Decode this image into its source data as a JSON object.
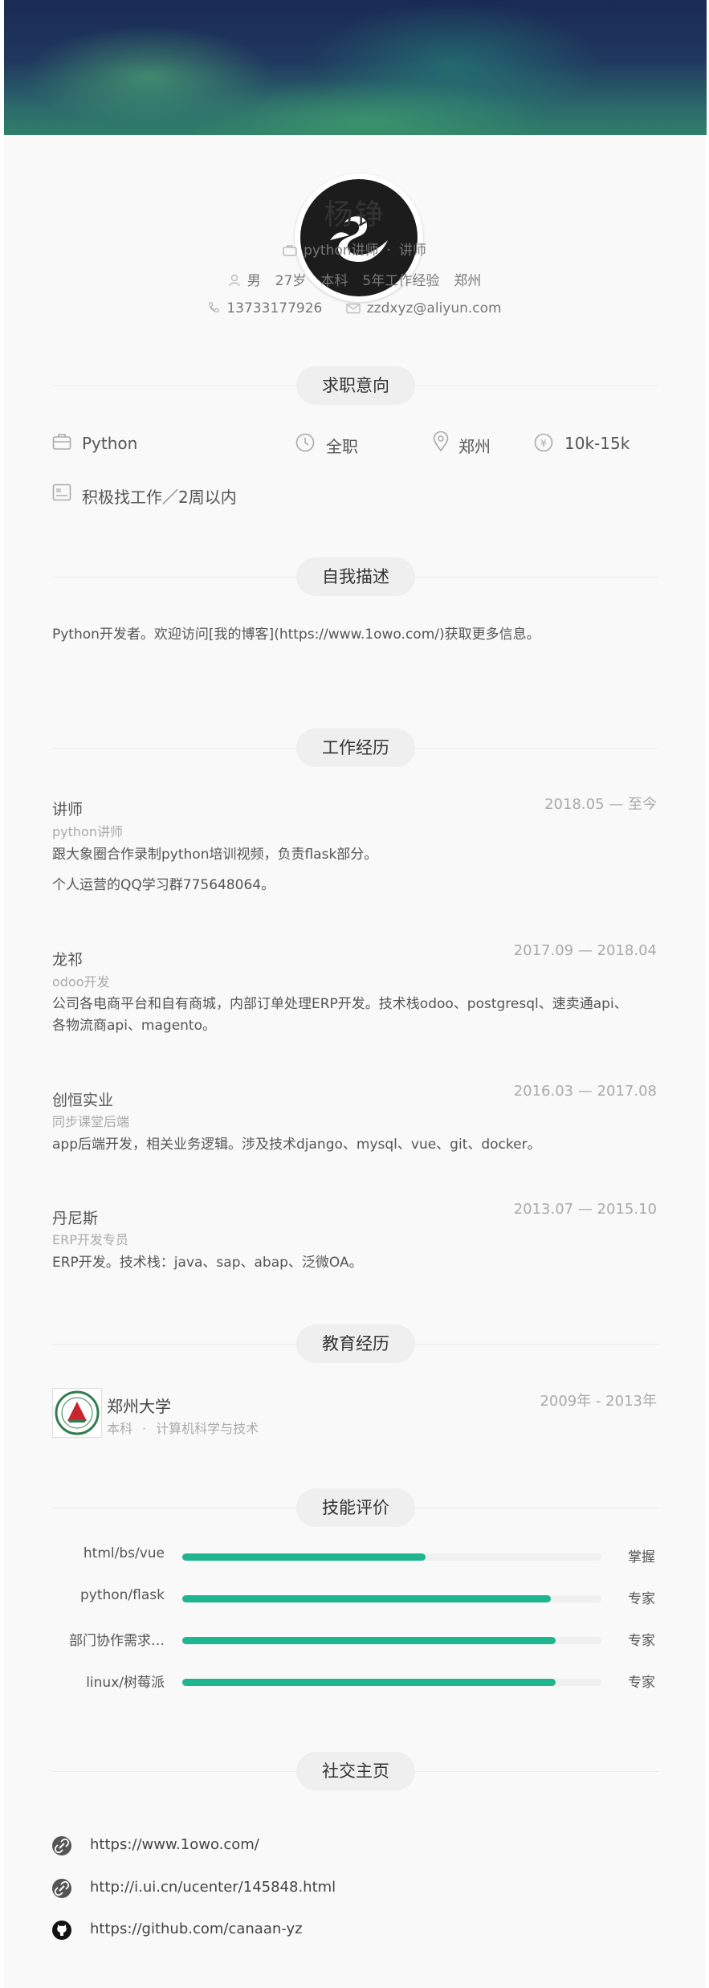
{
  "profile": {
    "name": "杨铮",
    "title": "python讲师",
    "title2": "讲师",
    "dot": "·",
    "gender": "男",
    "age": "27岁",
    "degree": "本科",
    "experience": "5年工作经验",
    "city": "郑州",
    "phone": "13733177926",
    "email": "zzdxyz@aliyun.com"
  },
  "sections": {
    "intent": "求职意向",
    "about": "自我描述",
    "work": "工作经历",
    "edu": "教育经历",
    "skills": "技能评价",
    "social": "社交主页"
  },
  "intent": {
    "position": "Python",
    "type": "全职",
    "city": "郑州",
    "salary": "10k-15k",
    "status": "积极找工作／2周以内"
  },
  "about": {
    "text": "Python开发者。欢迎访问[我的博客](https://www.1owo.com/)获取更多信息。"
  },
  "work": [
    {
      "company": "讲师",
      "role": "python讲师",
      "date": "2018.05 — 至今",
      "desc1": "跟大象圈合作录制python培训视频，负责flask部分。",
      "desc2": "个人运营的QQ学习群775648064。"
    },
    {
      "company": "龙祁",
      "role": "odoo开发",
      "date": "2017.09 — 2018.04",
      "desc1": "公司各电商平台和自有商城，内部订单处理ERP开发。技术栈odoo、postgresql、速卖通api、",
      "desc2": "各物流商api、magento。"
    },
    {
      "company": "创恒实业",
      "role": "同步课堂后端",
      "date": "2016.03 — 2017.08",
      "desc1": "app后端开发，相关业务逻辑。涉及技术django、mysql、vue、git、docker。"
    },
    {
      "company": "丹尼斯",
      "role": "ERP开发专员",
      "date": "2013.07 — 2015.10",
      "desc1": "ERP开发。技术栈：java、sap、abap、泛微OA。"
    }
  ],
  "education": {
    "school": "郑州大学",
    "degree": "本科",
    "dot": "·",
    "major": "计算机科学与技术",
    "date": "2009年 - 2013年"
  },
  "skills": [
    {
      "name": "html/bs/vue",
      "level": "掌握",
      "progress": 0.58
    },
    {
      "name": "python/flask",
      "level": "专家",
      "progress": 0.88
    },
    {
      "name": "部门协作需求…",
      "level": "专家",
      "progress": 0.89
    },
    {
      "name": "linux/树莓派",
      "level": "专家",
      "progress": 0.89
    }
  ],
  "social": [
    {
      "url": "https://www.1owo.com/",
      "icon": "link-icon"
    },
    {
      "url": "http://i.ui.cn/ucenter/145848.html",
      "icon": "link-icon"
    },
    {
      "url": "https://github.com/canaan-yz",
      "icon": "github-icon"
    }
  ],
  "colors": {
    "accent": "#1fb58e",
    "card": "#f9f9f9",
    "pill": "#efefef"
  }
}
